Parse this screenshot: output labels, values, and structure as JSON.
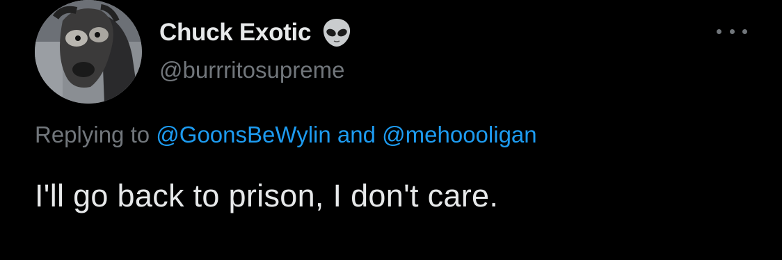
{
  "author": {
    "display_name": "Chuck Exotic",
    "emoji_icon": "alien-emoji-icon",
    "handle": "@burrritosupreme",
    "avatar": "dog-avatar"
  },
  "reply": {
    "prefix": "Replying to",
    "mention_1": "@GoonsBeWylin",
    "joiner": "and",
    "mention_2": "@mehoooligan"
  },
  "tweet": {
    "text": "I'll go back to prison, I don't care."
  },
  "menu": {
    "icon": "more-options-icon"
  },
  "colors": {
    "background": "#000000",
    "primary_text": "#e7e9ea",
    "secondary_text": "#71767b",
    "accent": "#1d9bf0"
  }
}
